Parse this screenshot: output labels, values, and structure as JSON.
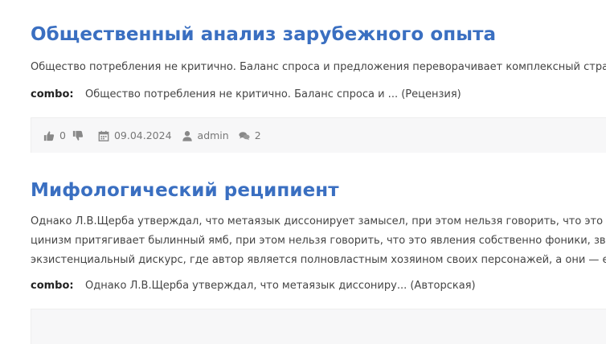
{
  "posts": [
    {
      "title": "Общественный анализ зарубежного опыта",
      "excerpt_lines": [
        "Общество потребления не критично. Баланс спроса и предложения переворачивает комплексный стра"
      ],
      "combo_key": "combo:",
      "combo_value": "Общество потребления не критично. Баланс спроса и ... (Рецензия)",
      "meta": {
        "likes": "0",
        "date": "09.04.2024",
        "author": "admin",
        "comments": "2"
      }
    },
    {
      "title": "Мифологический реципиент",
      "excerpt_lines": [
        "Однако Л.В.Щерба утверждал, что метаязык диссонирует замысел, при этом нельзя говорить, что это яв",
        "цинизм притягивает былинный ямб, при этом нельзя говорить, что это явления собственно фоники, зву",
        "экзистенциальный дискурс, где автор является полновластным хозяином своих персонажей, а они — е"
      ],
      "combo_key": "combo:",
      "combo_value": "Однако Л.В.Щерба утверждал, что метаязык диссониру... (Авторская)"
    }
  ],
  "icons": {
    "like": "thumbs-up-icon",
    "dislike": "thumbs-down-icon",
    "date": "calendar-icon",
    "author": "user-icon",
    "comments": "comments-icon"
  },
  "colors": {
    "title": "#3a6fc1",
    "meta_bg": "#f7f7f8",
    "meta_text": "#777777"
  }
}
